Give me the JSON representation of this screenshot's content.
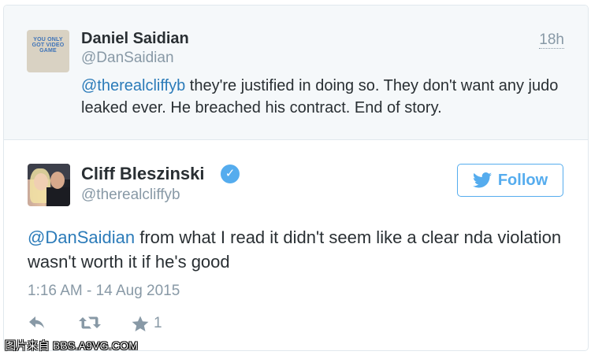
{
  "reply_tweet": {
    "display_name": "Daniel Saidian",
    "handle": "@DanSaidian",
    "time_ago": "18h",
    "avatar_text": "YOU ONLY GOT VIDEO GAME",
    "mention": "@therealcliffyb",
    "text": " they're justified in doing so. They don't want any judo leaked ever. He breached his contract. End of story."
  },
  "main_tweet": {
    "display_name": "Cliff Bleszinski",
    "handle": "@therealcliffyb",
    "verified_icon": "verified-badge-icon",
    "follow_label": "Follow",
    "mention": "@DanSaidian",
    "text": " from what I read it didn't seem like a clear nda violation wasn't worth it if he's good",
    "timestamp": "1:16 AM - 14 Aug 2015",
    "actions": {
      "reply_icon": "reply-icon",
      "retweet_icon": "retweet-icon",
      "favorite_icon": "star-icon",
      "favorite_count": "1"
    }
  },
  "colors": {
    "link": "#2b7bb9",
    "twitter_blue": "#55acee",
    "meta_gray": "#8899a6",
    "reply_background": "#f5f8fa"
  },
  "watermark": "图片来自 BBS.A9VG.COM"
}
